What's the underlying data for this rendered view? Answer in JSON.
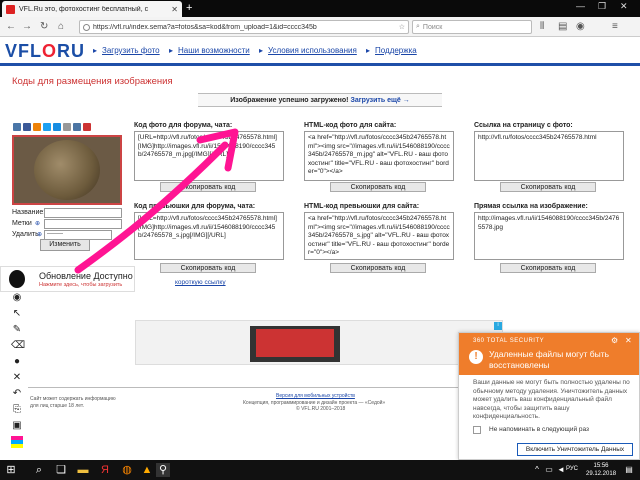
{
  "browser": {
    "tab_title": "VFL.Ru это, фотохостинг бесплатный, с",
    "new_tab": "+",
    "url": "https://vfl.ru/index.sema?a=fotos&sa=kod&from_upload=1&id=cccc345b",
    "search_placeholder": "Поиск"
  },
  "site": {
    "logo_pre": "VFL",
    "logo_o": "O",
    "logo_post": "RU",
    "nav": [
      "Загрузить фото",
      "Наши возможности",
      "Условия использования",
      "Поддержка"
    ]
  },
  "page": {
    "title": "Коды для размещения изображения",
    "success_text": "Изображение успешно загружено!",
    "upload_more": "Загрузить ещё →"
  },
  "sidebar": {
    "name_label": "Название:",
    "tags_label": "Метки",
    "delete_label": "Удалить",
    "delete_value": "--------",
    "rename_button": "Изменить"
  },
  "codes": {
    "c1_title": "Код фото для форума, чата:",
    "c1_value": "[URL=http://vfl.ru/fotos/cccc345b24765578.html][IMG]http://images.vfl.ru/ii/1546088190/cccc345b/24765578_m.jpg[/IMG][/URL]",
    "c2_title": "HTML-код фото для сайта:",
    "c2_value": "<a href=\"http://vfl.ru/fotos/cccc345b24765578.html\"><img src=\"//images.vfl.ru/ii/1546088190/cccc345b/24765578_m.jpg\" alt=\"VFL.RU - ваш фотохостинг\" title=\"VFL.RU - ваш фотохостинг\" border=\"0\"></a>",
    "c3_title": "Ссылка на страницу с фото:",
    "c3_value": "http://vfl.ru/fotos/cccc345b24765578.html",
    "c4_title": "Код превьюшки для форума, чата:",
    "c4_value": "[URL=http://vfl.ru/fotos/cccc345b24765578.html][IMG]http://images.vfl.ru/ii/1546088190/cccc345b/24765578_s.jpg[/IMG][/URL]",
    "c5_title": "HTML-код превьюшки для сайта:",
    "c5_value": "<a href=\"http://vfl.ru/fotos/cccc345b24765578.html\"><img src=\"//images.vfl.ru/ii/1546088190/cccc345b/24765578_s.jpg\" alt=\"VFL.RU - ваш фотохостинг\" title=\"VFL.RU - ваш фотохостинг\" border=\"0\"></a>",
    "c6_title": "Прямая ссылка на изображение:",
    "c6_value": "http://images.vfl.ru/ii/1546088190/cccc345b/24765578.jpg",
    "copy_button": "Скопировать код",
    "short_link": "короткую ссылку"
  },
  "update_popup": {
    "title": "Обновление Доступно",
    "subtitle": "Нажмите здесь, чтобы загрузить"
  },
  "footer": {
    "mobile_link": "Версия для мобильных устройств",
    "line1": "Концепция, программирование и дизайн проекта — «Седой»",
    "line2": "© VFL.RU 2001–2018",
    "left1": "Сайт может содержать информацию",
    "left2": "для лиц старше 18 лет."
  },
  "notification": {
    "brand": "360 TOTAL SECURITY",
    "title": "Удаленные файлы могут быть восстановлены",
    "body": "Ваши данные не могут быть полностью удалены по обычному методу удаления. Уничтожитель данных может удалить ваш конфиденциальный файл навсегда, чтобы защитить вашу конфиденциальность.",
    "checkbox_label": "Не напоминать в следующий раз",
    "button": "Включить Уничтожитель Данных"
  },
  "taskbar": {
    "lang": "РУС",
    "time": "15:56",
    "date": "29.12.2018"
  },
  "colors": {
    "brand_blue": "#1b4ea6",
    "title_red": "#cc3333",
    "arrow_pink": "#ff1493",
    "notif_orange": "#ef7d2b"
  }
}
